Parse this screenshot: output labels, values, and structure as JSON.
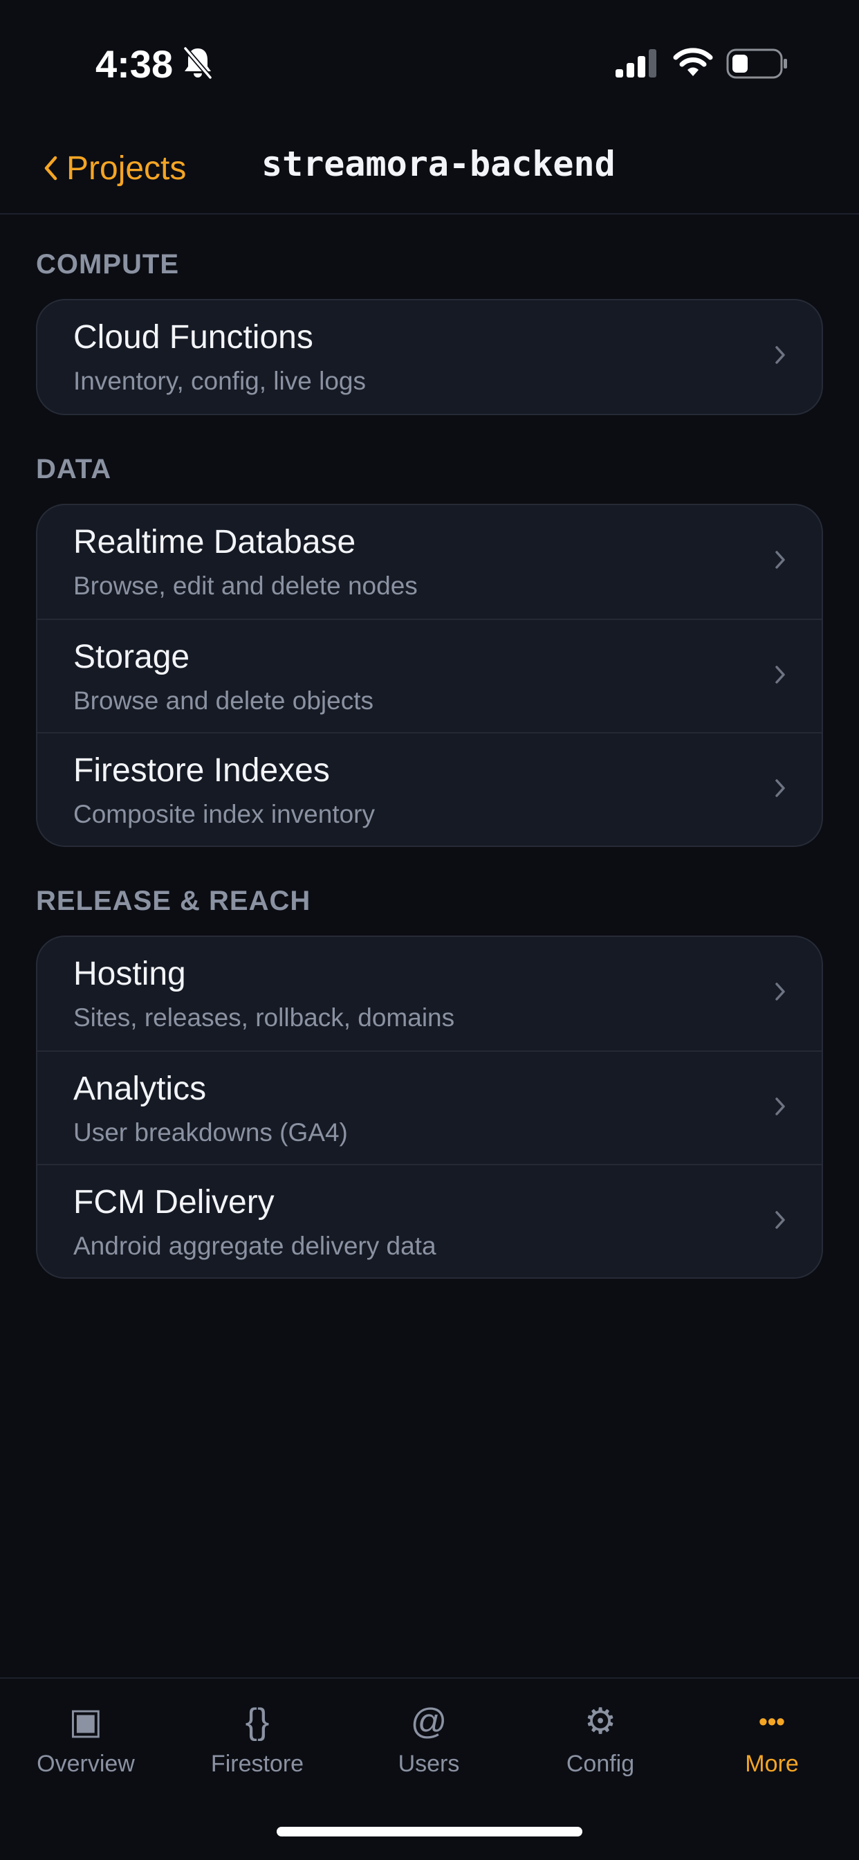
{
  "status_bar": {
    "time": "4:38",
    "icons": [
      "bell-slash-icon",
      "signal-icon",
      "wifi-icon",
      "battery-icon"
    ]
  },
  "nav": {
    "back_label": "Projects",
    "title": "streamora-backend"
  },
  "sections": [
    {
      "header": "COMPUTE",
      "rows": [
        {
          "title": "Cloud Functions",
          "subtitle": "Inventory, config, live logs"
        }
      ]
    },
    {
      "header": "DATA",
      "rows": [
        {
          "title": "Realtime Database",
          "subtitle": "Browse, edit and delete nodes"
        },
        {
          "title": "Storage",
          "subtitle": "Browse and delete objects"
        },
        {
          "title": "Firestore Indexes",
          "subtitle": "Composite index inventory"
        }
      ]
    },
    {
      "header": "RELEASE & REACH",
      "rows": [
        {
          "title": "Hosting",
          "subtitle": "Sites, releases, rollback, domains"
        },
        {
          "title": "Analytics",
          "subtitle": "User breakdowns (GA4)"
        },
        {
          "title": "FCM Delivery",
          "subtitle": "Android aggregate delivery data"
        }
      ]
    }
  ],
  "tabs": [
    {
      "label": "Overview",
      "icon": "▣",
      "icon_name": "overview-icon"
    },
    {
      "label": "Firestore",
      "icon": "{}",
      "icon_name": "braces-icon"
    },
    {
      "label": "Users",
      "icon": "@",
      "icon_name": "at-icon"
    },
    {
      "label": "Config",
      "icon": "⚙",
      "icon_name": "gear-icon"
    },
    {
      "label": "More",
      "icon": "•••",
      "icon_name": "more-icon",
      "active": true
    }
  ],
  "colors": {
    "background": "#0b0d13",
    "card": "#161a24",
    "accent": "#f5a524",
    "secondary_text": "#8b92a2"
  }
}
